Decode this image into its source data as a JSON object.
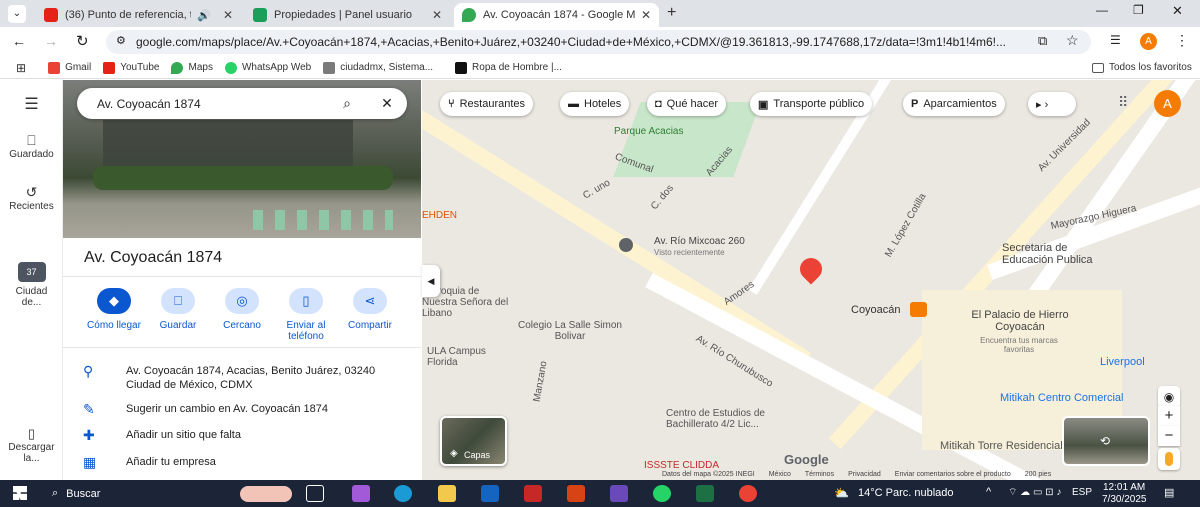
{
  "tabs": [
    {
      "title": "(36) Punto de referencia, tu",
      "color": "#e62117"
    },
    {
      "title": "Propiedades | Panel usuario",
      "color": "#1b9e5a"
    },
    {
      "title": "Av. Coyoacán 1874 - Google M",
      "color": "#34a853"
    }
  ],
  "address": {
    "url": "google.com/maps/place/Av.+Coyoacán+1874,+Acacias,+Benito+Juárez,+03240+Ciudad+de+México,+CDMX/@19.361813,-99.1747688,17z/data=!3m1!4b1!4m6!..."
  },
  "bookmarks": [
    {
      "label": "Gmail",
      "color": "#ea4335"
    },
    {
      "label": "YouTube",
      "color": "#e62117"
    },
    {
      "label": "Maps",
      "color": "#34a853"
    },
    {
      "label": "WhatsApp Web",
      "color": "#25d366"
    },
    {
      "label": "ciudadmx, Sistema...",
      "color": "#7a7a7a"
    },
    {
      "label": "Ropa de Hombre |...",
      "color": "#111"
    }
  ],
  "bookmarks_all": "Todos los favoritos",
  "rail": {
    "saved": "Guardado",
    "recent": "Recientes",
    "city": "Ciudad de...",
    "city_badge": "37",
    "download": "Descargar la..."
  },
  "search": {
    "value": "Av. Coyoacán 1874"
  },
  "place": {
    "title": "Av. Coyoacán 1874",
    "address": "Av. Coyoacán 1874, Acacias, Benito Juárez, 03240 Ciudad de México, CDMX",
    "suggest": "Sugerir un cambio en Av. Coyoacán 1874",
    "missing": "Añadir un sitio que falta",
    "business": "Añadir tu empresa"
  },
  "actions": [
    "Cómo llegar",
    "Guardar",
    "Cercano",
    "Enviar al teléfono",
    "Compartir"
  ],
  "chips": [
    "Restaurantes",
    "Hoteles",
    "Qué hacer",
    "Transporte público",
    "Aparcamientos"
  ],
  "map_labels": [
    "Parque Acacias",
    "Av. Río Mixcoac 260",
    "Visto recientemente",
    "Coyoacán",
    "Secretaria de Educación Publica",
    "El Palacio de Hierro Coyoacán",
    "Encuentra tus marcas favoritas",
    "Liverpool",
    "Mitikah Centro Comercial",
    "Mitikah Torre Residencial",
    "Colegio La Salle Simon Bolivar",
    "ULA Campus Florida",
    "Centro de Estudios de Bachillerato 4/2 Lic...",
    "ISSSTE CLIDDA",
    "Parroquia de Nuestra Señora del Libano",
    "EHDEN",
    "Mayorazgo Higuera",
    "Av. Universidad",
    "M. López Cotilla",
    "Amores",
    "Av. Río Churubusco",
    "Manzano",
    "Comunal",
    "Acacias",
    "C. dos",
    "C. uno"
  ],
  "map_footer": {
    "data": "Datos del mapa ©2025 INEGI",
    "country": "México",
    "terms": "Términos",
    "privacy": "Privacidad",
    "feedback": "Enviar comentarios sobre el producto",
    "scale": "200 pies"
  },
  "layers": "Capas",
  "avatar": "A",
  "taskbar": {
    "search": "Buscar",
    "weather": "14°C Parc. nublado",
    "lang": "ESP",
    "time": "12:01 AM",
    "date": "7/30/2025"
  }
}
